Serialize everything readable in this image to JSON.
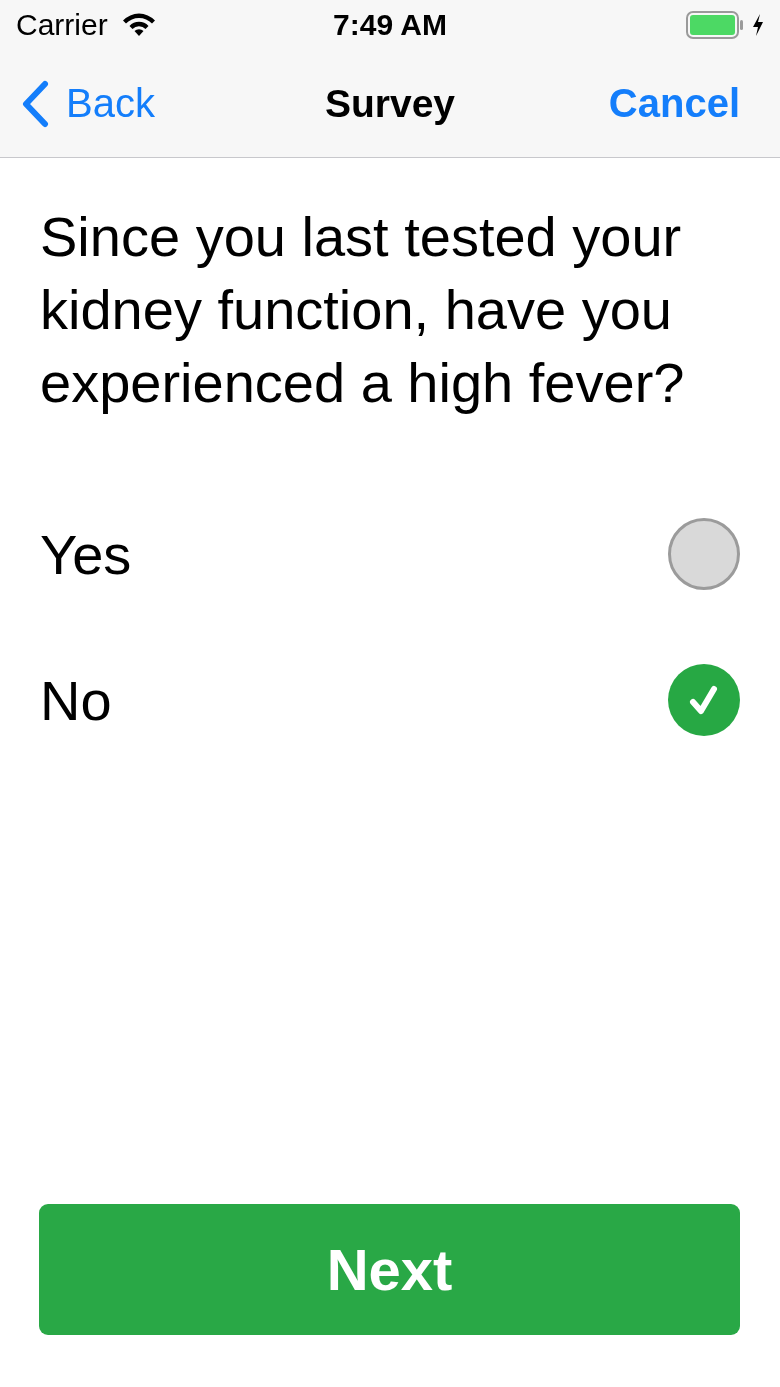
{
  "status_bar": {
    "carrier": "Carrier",
    "time": "7:49 AM",
    "charging": true
  },
  "nav_bar": {
    "back": "Back",
    "title": "Survey",
    "action": "Cancel"
  },
  "question": "Since you last tested your kidney function, have you experienced a high fever?",
  "options": [
    {
      "label": "Yes",
      "selected": false
    },
    {
      "label": "No",
      "selected": true
    }
  ],
  "next_button": "Next"
}
